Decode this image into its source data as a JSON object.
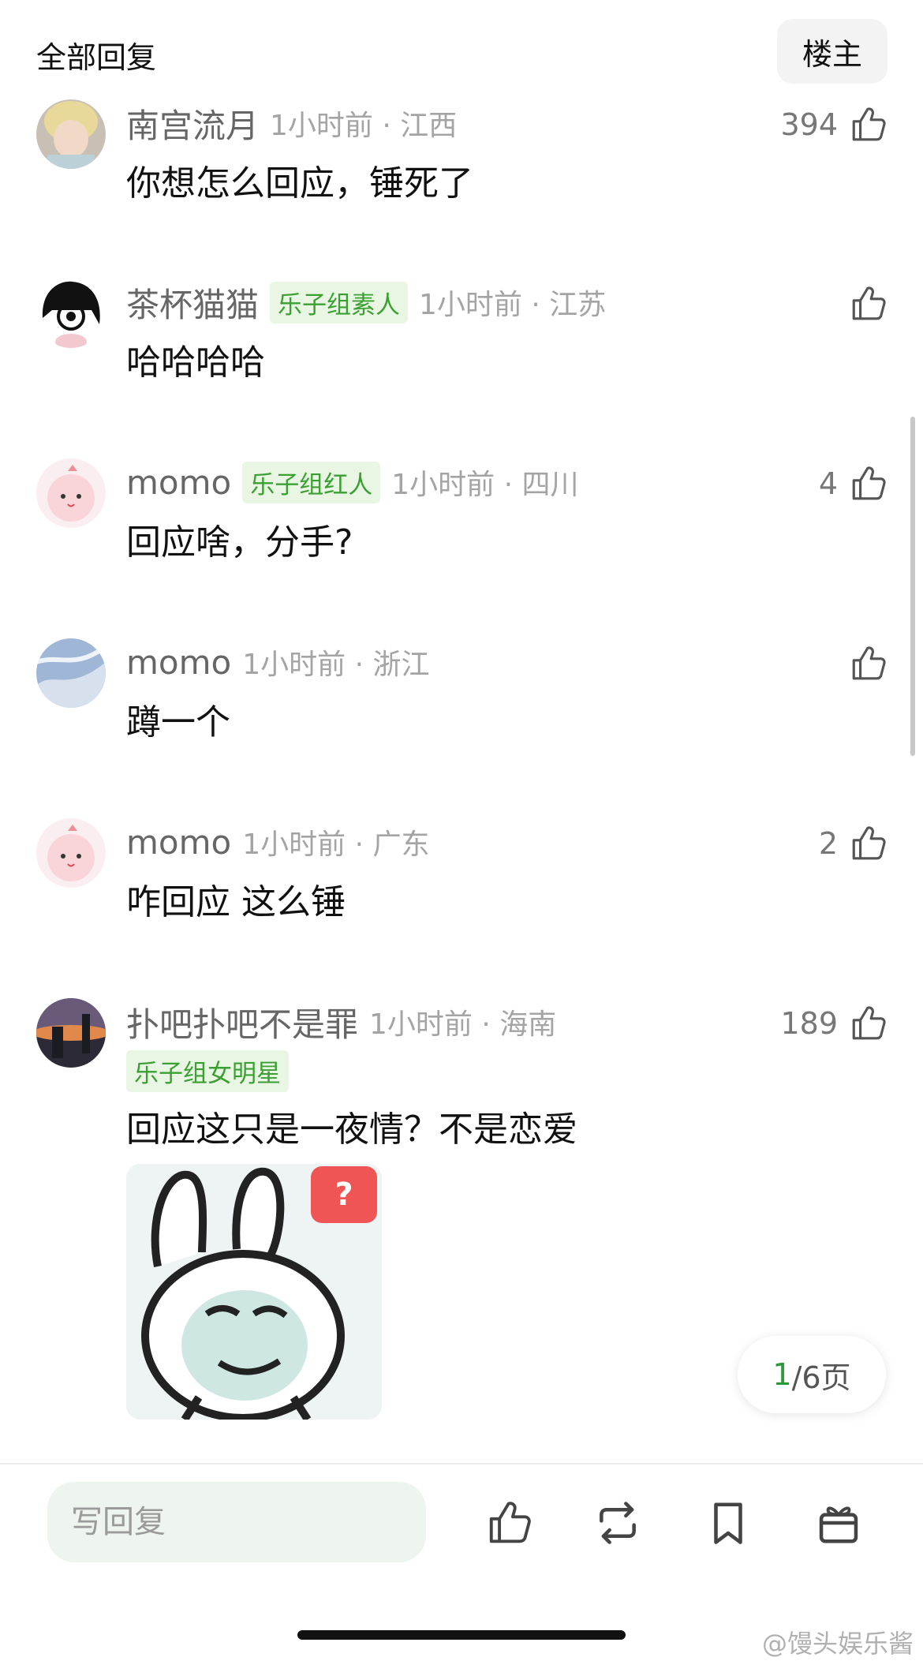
{
  "header": {
    "title": "全部回复",
    "op_label": "楼主"
  },
  "comments": [
    {
      "username": "南宫流月",
      "badge": "",
      "time": "1小时前",
      "location": "江西",
      "time_loc": "1小时前 · 江西",
      "likes": "394",
      "text": "你想怎么回应，锤死了"
    },
    {
      "username": "茶杯猫猫",
      "badge": "乐子组素人",
      "time": "1小时前",
      "location": "江苏",
      "time_loc": "1小时前 · 江苏",
      "likes": "",
      "text": "哈哈哈哈"
    },
    {
      "username": "momo",
      "badge": "乐子组红人",
      "time": "1小时前",
      "location": "四川",
      "time_loc": "1小时前 · 四川",
      "likes": "4",
      "text": "回应啥，分手?"
    },
    {
      "username": "momo",
      "badge": "",
      "time": "1小时前",
      "location": "浙江",
      "time_loc": "1小时前 · 浙江",
      "likes": "",
      "text": "蹲一个"
    },
    {
      "username": "momo",
      "badge": "",
      "time": "1小时前",
      "location": "广东",
      "time_loc": "1小时前 · 广东",
      "likes": "2",
      "text": "咋回应 这么锤"
    },
    {
      "username": "扑吧扑吧不是罪",
      "badge": "乐子组女明星",
      "time": "1小时前",
      "location": "海南",
      "time_loc": "1小时前 · 海南",
      "likes": "189",
      "text": "回应这只是一夜情？不是恋爱",
      "sticker_mark": "?"
    }
  ],
  "pager": {
    "current": "1",
    "rest": "/6页"
  },
  "reply": {
    "placeholder": "写回复"
  },
  "actions": [
    "thumbs-up-icon",
    "repost-icon",
    "bookmark-icon",
    "gift-icon"
  ],
  "watermark": "@馒头娱乐酱",
  "colors": {
    "badge_bg": "#eaf6e4",
    "badge_text": "#3aa032",
    "accent": "#2a9a37",
    "reply_bg": "#edf5ee"
  }
}
